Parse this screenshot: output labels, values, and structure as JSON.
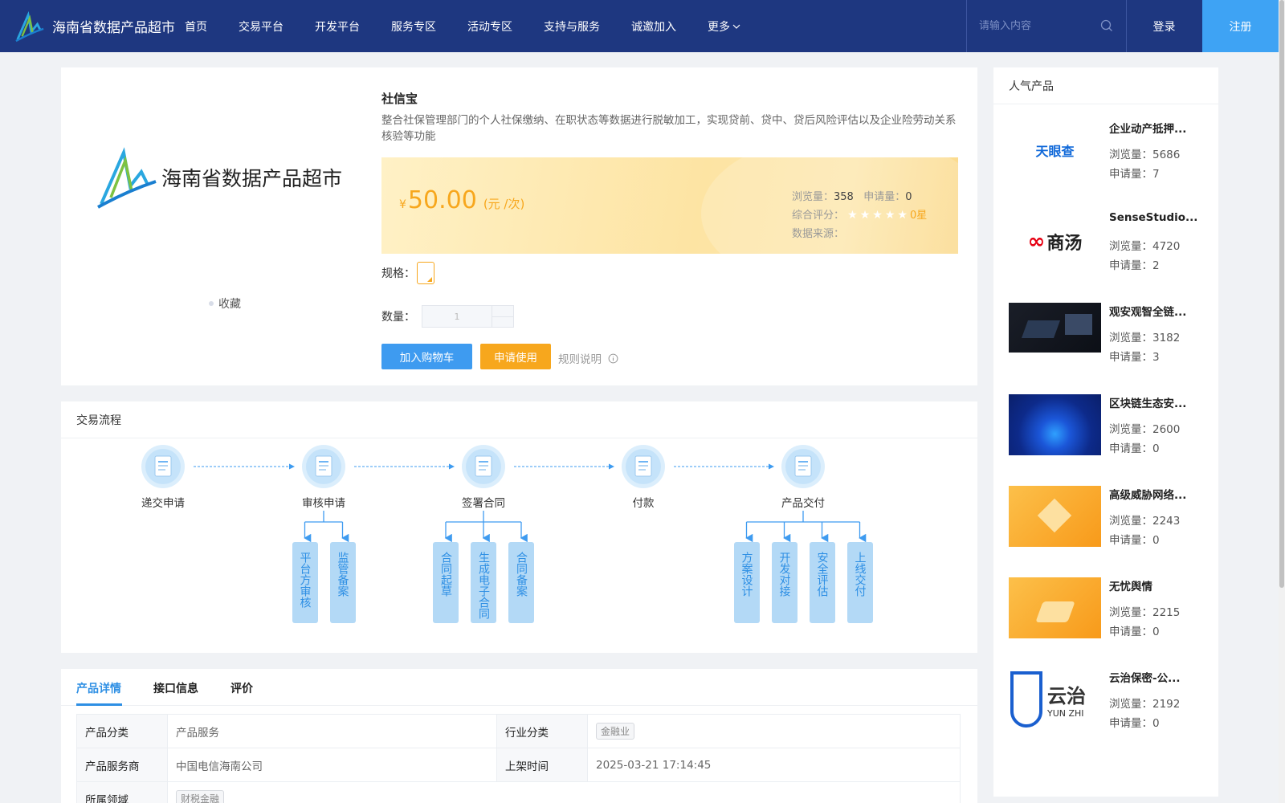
{
  "header": {
    "logo_text": "海南省数据产品超市",
    "nav": [
      "首页",
      "交易平台",
      "开发平台",
      "服务专区",
      "活动专区",
      "支持与服务",
      "诚邀加入"
    ],
    "more_label": "更多",
    "search_placeholder": "请输入内容",
    "login_label": "登录",
    "register_label": "注册"
  },
  "product": {
    "logo_text": "海南省数据产品超市",
    "favorite_label": "收藏",
    "title": "社信宝",
    "description": "整合社保管理部门的个人社保缴纳、在职状态等数据进行脱敏加工，实现贷前、贷中、贷后风险评估以及企业险劳动关系核验等功能",
    "price_symbol": "¥",
    "price": "50.00",
    "price_unit": "(元 /次)",
    "views_label": "浏览量：",
    "views": "358",
    "applications_label": "申请量：",
    "applications": "0",
    "rating_label": "综合评分：",
    "rating": 0,
    "rating_max": 5,
    "score_text": "0星",
    "source_label": "数据来源：",
    "spec_label": "规格：",
    "quantity_label": "数量：",
    "quantity_value": "1",
    "add_cart_label": "加入购物车",
    "apply_label": "申请使用",
    "rules_label": "规则说明"
  },
  "flow": {
    "title": "交易流程",
    "steps": [
      {
        "label": "递交申请",
        "icon": "submit-document-icon",
        "subs": []
      },
      {
        "label": "审核申请",
        "icon": "review-user-icon",
        "subs": [
          "平台方审核",
          "监管备案"
        ]
      },
      {
        "label": "签署合同",
        "icon": "sign-contract-icon",
        "subs": [
          "合同起草",
          "生成电子合同",
          "合同备案"
        ]
      },
      {
        "label": "付款",
        "icon": "payment-icon",
        "subs": []
      },
      {
        "label": "产品交付",
        "icon": "delivery-list-icon",
        "subs": [
          "方案设计",
          "开发对接",
          "安全评估",
          "上线交付"
        ]
      }
    ]
  },
  "detail": {
    "tabs": [
      "产品详情",
      "接口信息",
      "评价"
    ],
    "active_tab": 0,
    "rows": [
      {
        "k1": "产品分类",
        "v1": "产品服务",
        "k2": "行业分类",
        "v2_tag": "金融业"
      },
      {
        "k1": "产品服务商",
        "v1": "中国电信海南公司",
        "k2": "上架时间",
        "v2": "2025-03-21 17:14:45"
      },
      {
        "k1": "所属领域",
        "v1_tag": "财税金融"
      }
    ]
  },
  "sidebar": {
    "title": "人气产品",
    "views_label": "浏览量：",
    "applications_label": "申请量：",
    "items": [
      {
        "name": "企业动产抵押...",
        "views": "5686",
        "applications": "7",
        "thumb": "tianyancha-logo",
        "thumb_text": "天眼查"
      },
      {
        "name": "SenseStudio...",
        "views": "4720",
        "applications": "2",
        "thumb": "sensetime-logo",
        "thumb_text": "商汤"
      },
      {
        "name": "观安观智全链...",
        "views": "3182",
        "applications": "3",
        "thumb": "dark-device-image"
      },
      {
        "name": "区块链生态安...",
        "views": "2600",
        "applications": "0",
        "thumb": "blue-hologram-image"
      },
      {
        "name": "高级威胁网络...",
        "views": "2243",
        "applications": "0",
        "thumb": "orange-isometric-image"
      },
      {
        "name": "无忧舆情",
        "views": "2215",
        "applications": "0",
        "thumb": "orange-platform-image"
      },
      {
        "name": "云治保密-公...",
        "views": "2192",
        "applications": "0",
        "thumb": "yunzhi-logo",
        "thumb_text": "云治",
        "thumb_subtext": "YUN ZHI"
      }
    ]
  },
  "colors": {
    "header_bg": "#1e3780",
    "register_bg": "#3ea3f4",
    "accent_blue": "#3e9bf0",
    "accent_orange": "#f7a71d"
  }
}
